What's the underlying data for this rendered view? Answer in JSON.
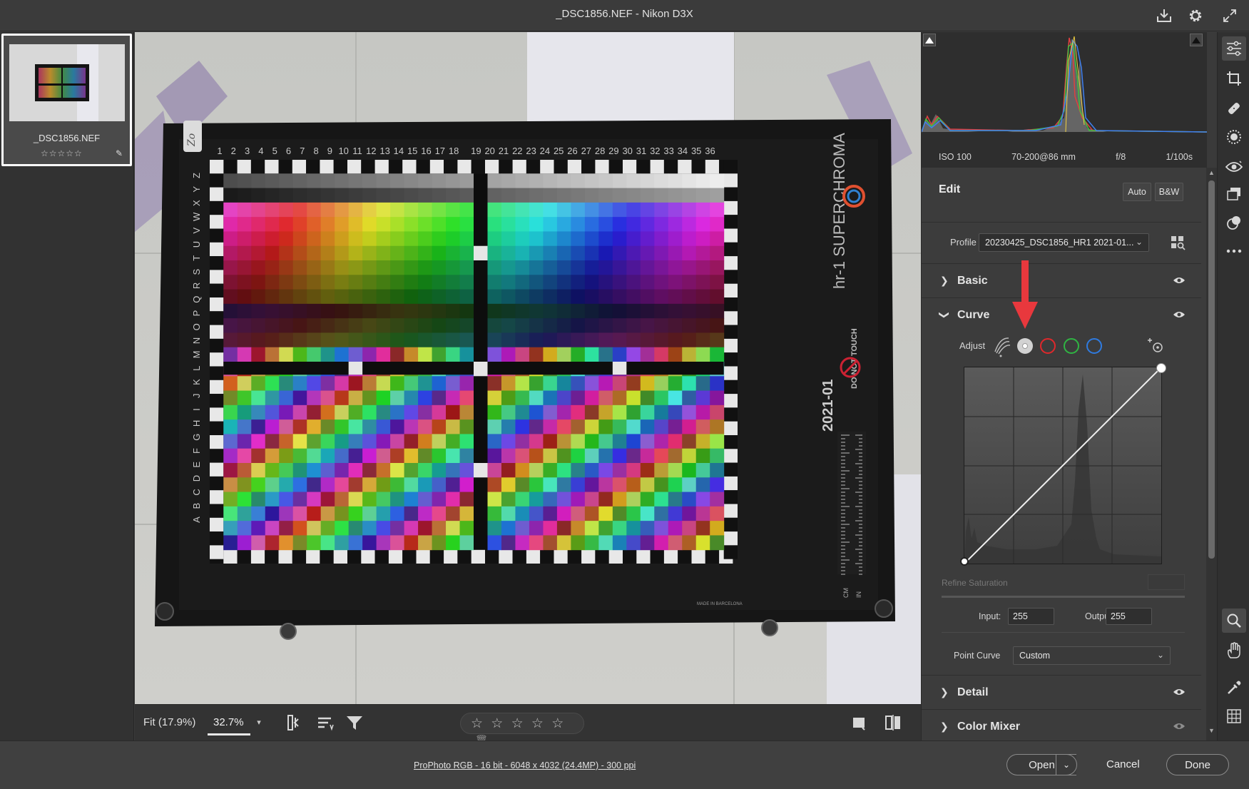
{
  "window": {
    "title": "_DSC1856.NEF  -  Nikon D3X",
    "icons": [
      "save-download-icon",
      "gear-icon",
      "fullscreen-icon"
    ]
  },
  "filmstrip": {
    "items": [
      {
        "filename": "_DSC1856.NEF",
        "rating": "☆☆☆☆☆",
        "selected": true
      }
    ]
  },
  "target_chart": {
    "brand": "hr-1 SUPERCHROMA",
    "date_code": "2021-01",
    "warning": "DO NOT TOUCH",
    "made_in": "MADE IN BARCELONA",
    "ruler_units": [
      "CM",
      "IN"
    ],
    "handwritten_mark": "Zo",
    "column_numbers": [
      "1",
      "2",
      "3",
      "4",
      "5",
      "6",
      "7",
      "8",
      "9",
      "10",
      "11",
      "12",
      "13",
      "14",
      "15",
      "16",
      "17",
      "18",
      "19",
      "20",
      "21",
      "22",
      "23",
      "24",
      "25",
      "26",
      "27",
      "28",
      "29",
      "30",
      "31",
      "32",
      "33",
      "34",
      "35",
      "36"
    ],
    "row_letters": [
      "Z",
      "Y",
      "X",
      "W",
      "V",
      "U",
      "T",
      "S",
      "R",
      "Q",
      "P",
      "O",
      "N",
      "M",
      "L",
      "K",
      "J",
      "I",
      "H",
      "G",
      "F",
      "E",
      "D",
      "C",
      "B",
      "A"
    ]
  },
  "viewer_toolbar": {
    "fit_label": "Fit (17.9%)",
    "zoom_value": "32.7%",
    "rating_stars": "☆ ☆ ☆ ☆ ☆"
  },
  "histogram": {
    "iso": "ISO 100",
    "lens": "70-200@86 mm",
    "aperture": "f/8",
    "shutter": "1/100s"
  },
  "edit": {
    "title": "Edit",
    "auto_label": "Auto",
    "bw_label": "B&W",
    "profile_label": "Profile",
    "profile_value": "20230425_DSC1856_HR1 2021-01...",
    "sections": {
      "basic": "Basic",
      "curve": "Curve",
      "detail": "Detail",
      "color_mixer": "Color Mixer"
    },
    "curve": {
      "adjust_label": "Adjust",
      "channels": [
        "parametric",
        "point-white",
        "red",
        "green",
        "blue"
      ],
      "selected_channel": "point-white",
      "refine_saturation_label": "Refine Saturation",
      "input_label": "Input:",
      "input_value": "255",
      "output_label": "Output:",
      "output_value": "255",
      "point_curve_label": "Point Curve",
      "point_curve_value": "Custom",
      "points": [
        {
          "input": 0,
          "output": 0
        },
        {
          "input": 255,
          "output": 255
        }
      ]
    }
  },
  "annotation": {
    "type": "red-arrow",
    "points_to": "point-white channel button"
  },
  "footer": {
    "workflow_info": "ProPhoto RGB - 16 bit - 6048 x 4032 (24.4MP) - 300 ppi",
    "open_label": "Open",
    "cancel_label": "Cancel",
    "done_label": "Done"
  },
  "colors": {
    "accent_red_arrow": "#e8383d",
    "channel_red": "#e0282b",
    "channel_green": "#2fb543",
    "channel_blue": "#2f7be0"
  }
}
